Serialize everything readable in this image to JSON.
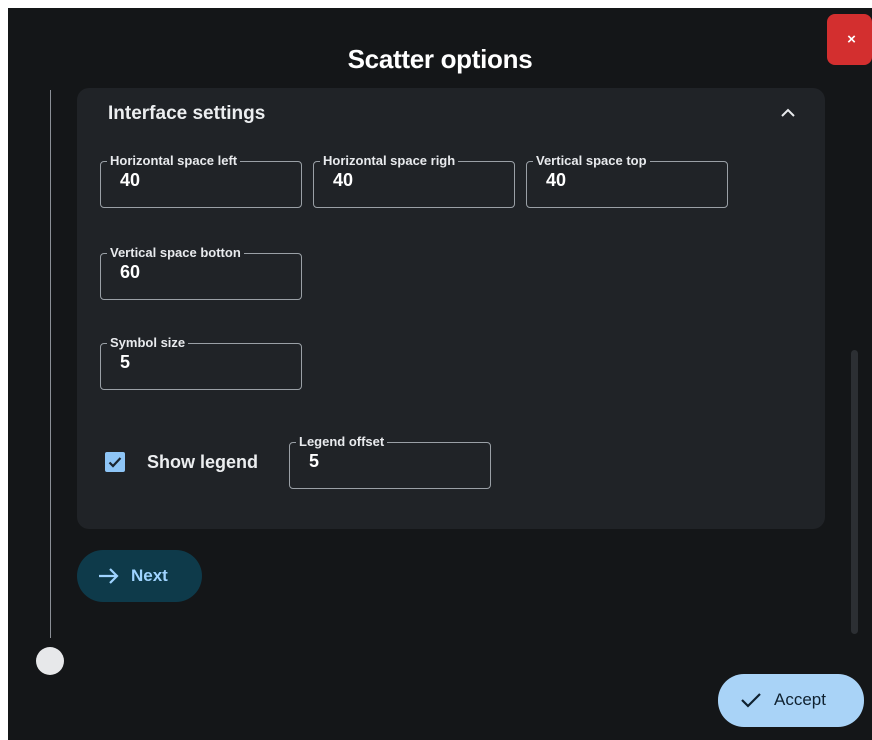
{
  "dialog": {
    "title": "Scatter options",
    "close_label": "×"
  },
  "panel": {
    "title": "Interface settings",
    "fields": {
      "h_space_left": {
        "label": "Horizontal space left",
        "value": "40"
      },
      "h_space_right": {
        "label": "Horizontal space righ",
        "value": "40"
      },
      "v_space_top": {
        "label": "Vertical space top",
        "value": "40"
      },
      "v_space_bottom": {
        "label": "Vertical space botton",
        "value": "60"
      },
      "symbol_size": {
        "label": "Symbol size",
        "value": "5"
      },
      "legend_offset": {
        "label": "Legend offset",
        "value": "5"
      }
    },
    "show_legend": {
      "label": "Show legend",
      "checked": true
    }
  },
  "actions": {
    "next_label": "Next",
    "accept_label": "Accept"
  },
  "colors": {
    "background": "#141618",
    "panel": "#202327",
    "close": "#d32f2f",
    "accent": "#8ec5f6",
    "next_bg": "#0e3a4a",
    "accept_bg": "#a9d3f7"
  }
}
